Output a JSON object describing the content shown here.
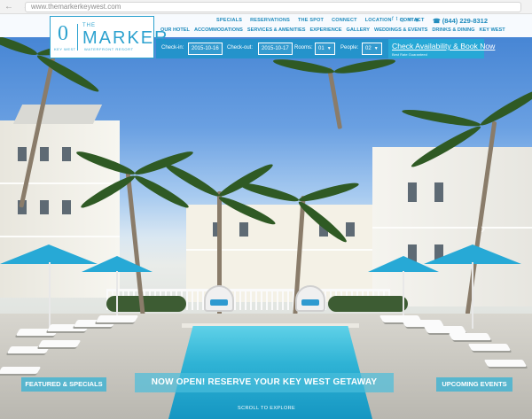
{
  "browser": {
    "url": "www.themarkerkeywest.com",
    "nav_arrows": "← →"
  },
  "logo": {
    "mark": "0",
    "mark_caption": "KEY WEST",
    "the": "THE",
    "name": "MARKER",
    "tagline": "WATERFRONT RESORT"
  },
  "utility_nav": {
    "links": [
      "SPECIALS",
      "RESERVATIONS",
      "THE SPOT",
      "CONNECT",
      "LOCATION",
      "CONTACT"
    ],
    "social_icons": [
      "facebook-icon",
      "twitter-icon",
      "instagram-icon",
      "email-icon",
      "tripadvisor-icon"
    ],
    "social_glyphs": [
      "f",
      "t",
      "◎",
      "✉",
      "◉"
    ],
    "phone_glyph": "☎",
    "phone": "(844) 229-8312"
  },
  "main_nav": {
    "links": [
      "OUR HOTEL",
      "ACCOMMODATIONS",
      "SERVICES & AMENITIES",
      "EXPERIENCE",
      "GALLERY",
      "WEDDINGS & EVENTS",
      "DRINKS & DINING",
      "KEY WEST"
    ]
  },
  "booking": {
    "checkin_label": "Check-in:",
    "checkin_value": "2015-10-16",
    "checkout_label": "Check-out:",
    "checkout_value": "2015-10-17",
    "rooms_label": "Rooms:",
    "rooms_value": "01",
    "people_label": "People:",
    "people_value": "02",
    "caret": "▼",
    "cta_label": "Check Availability & Book Now",
    "cta_sub": "Best Rate Guaranteed"
  },
  "hero": {
    "left_ribbon": "FEATURED & SPECIALS",
    "center_ribbon": "NOW OPEN! RESERVE YOUR KEY WEST GETAWAY",
    "right_ribbon": "UPCOMING EVENTS",
    "scroll_hint": "SCROLL TO EXPLORE",
    "next_arrow": "›"
  },
  "colors": {
    "brand_blue": "#1f8bbd",
    "booking_bar": "#1896c8",
    "ribbon": "#3ab2d4",
    "pool": "#2fb3d5"
  }
}
